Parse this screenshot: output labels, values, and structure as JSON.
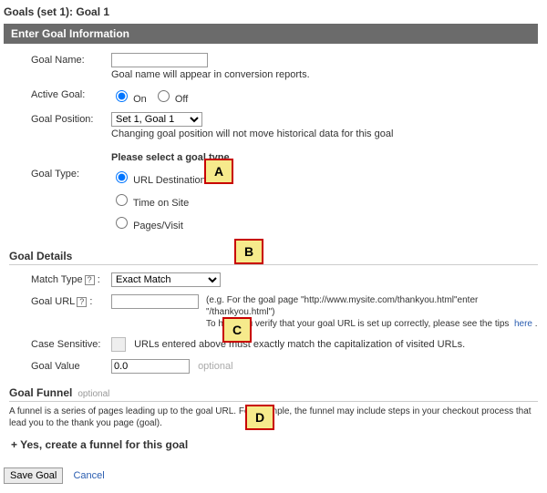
{
  "page_title": "Goals (set 1): Goal 1",
  "section_header": "Enter Goal Information",
  "goal_name": {
    "label": "Goal Name:",
    "value": "",
    "hint": "Goal name will appear in conversion reports."
  },
  "active_goal": {
    "label": "Active Goal:",
    "on": "On",
    "off": "Off",
    "selected": "on"
  },
  "goal_position": {
    "label": "Goal Position:",
    "selected": "Set 1, Goal 1",
    "hint": "Changing goal position will not move historical data for this goal"
  },
  "goal_type": {
    "label": "Goal Type:",
    "prompt": "Please select a goal type",
    "options": {
      "url": "URL Destination",
      "time": "Time on Site",
      "pages": "Pages/Visit"
    },
    "selected": "url"
  },
  "goal_details": {
    "title": "Goal Details",
    "match_type": {
      "label": "Match Type",
      "selected": "Exact Match"
    },
    "goal_url": {
      "label": "Goal URL",
      "value": "",
      "hint_eg": "(e.g. For the goal page \"http://www.mysite.com/thankyou.html\"enter \"/thankyou.html\")",
      "hint_tip": "To help you verify that your goal URL is set up correctly, please see the tips",
      "here": "here",
      "period": "."
    },
    "case_sensitive": {
      "label": "Case Sensitive:",
      "desc": "URLs entered above must exactly match the capitalization of visited URLs."
    },
    "goal_value": {
      "label": "Goal Value",
      "value": "0.0",
      "optional": "optional"
    }
  },
  "goal_funnel": {
    "title": "Goal Funnel",
    "optional": "optional",
    "desc": "A funnel is a series of pages leading up to the goal URL. For example, the funnel may include steps in your checkout process that lead you to the thank you page (goal).",
    "toggle": "+ Yes, create a funnel for this goal"
  },
  "footer": {
    "save": "Save Goal",
    "cancel": "Cancel"
  },
  "annotations": {
    "A": "A",
    "B": "B",
    "C": "C",
    "D": "D"
  }
}
